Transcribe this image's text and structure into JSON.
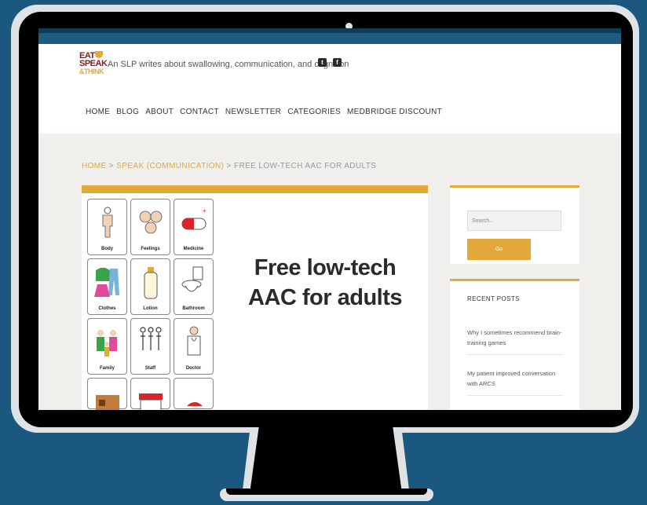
{
  "site": {
    "logo_line1": "EAT",
    "logo_line2": "SPEAK",
    "logo_line3": "&THINK",
    "tagline": "An SLP writes about swallowing, communication, and cognition",
    "social": [
      "twitter-icon",
      "facebook-icon"
    ]
  },
  "nav": {
    "items": [
      "HOME",
      "BLOG",
      "ABOUT",
      "CONTACT",
      "NEWSLETTER",
      "CATEGORIES",
      "MEDBRIDGE DISCOUNT"
    ]
  },
  "breadcrumb": {
    "home": "HOME",
    "sep1": " > ",
    "category": "SPEAK (COMMUNICATION)",
    "sep2": " > ",
    "current": "FREE LOW-TECH AAC FOR ADULTS"
  },
  "article": {
    "title_line1": "Free low-tech",
    "title_line2": "AAC for adults",
    "board_labels": [
      "Body",
      "Feelings",
      "Medicine",
      "Clothes",
      "Lotion",
      "Bathroom",
      "Family",
      "Staff",
      "Doctor"
    ]
  },
  "sidebar": {
    "search_placeholder": "Search..",
    "go_label": "Go",
    "recent_title": "RECENT POSTS",
    "recent_posts": [
      "Why I sometimes recommend brain-training games",
      "My patient improved conversation with ARCS"
    ]
  },
  "colors": {
    "accent": "#e2a93a",
    "brand": "#8a1b24",
    "background": "#1a5880"
  }
}
